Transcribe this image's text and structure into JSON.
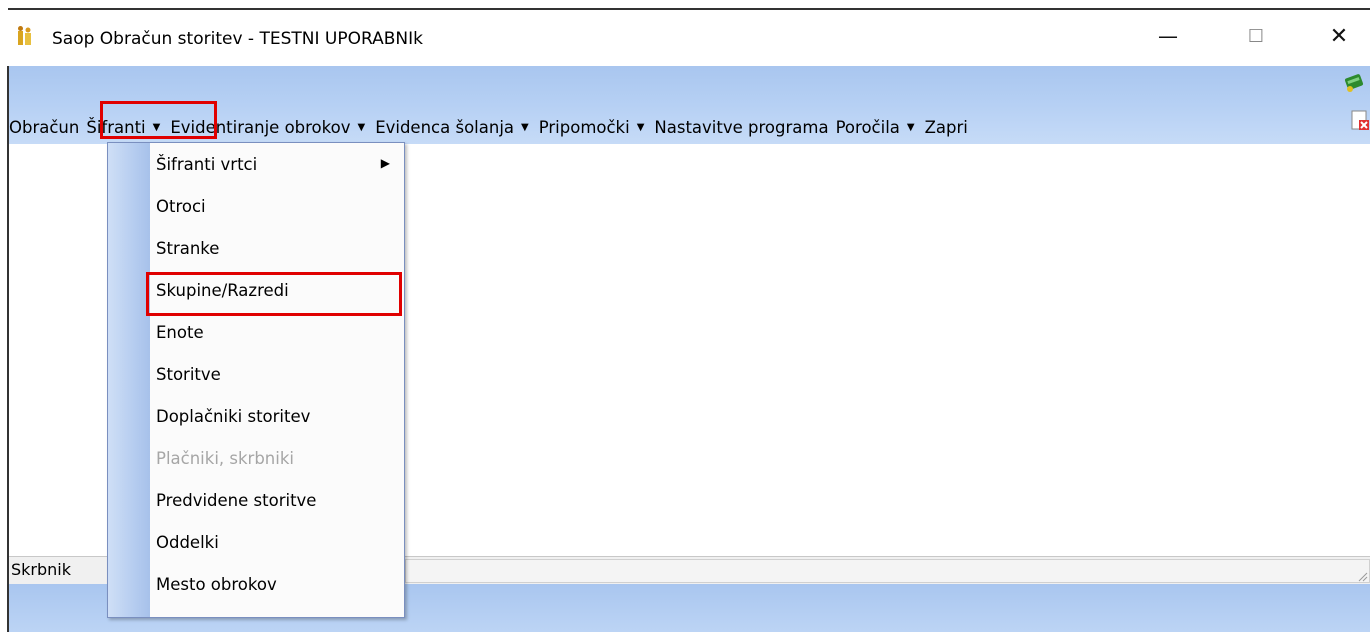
{
  "window": {
    "title": "Saop Obračun storitev - TESTNI UPORABNIk",
    "minimize_glyph": "—",
    "maximize_glyph": "☐",
    "close_glyph": "✕"
  },
  "menubar": {
    "items": [
      {
        "label": "Obračun",
        "has_caret": false
      },
      {
        "label": "Šifranti",
        "has_caret": true
      },
      {
        "label": "Evidentiranje obrokov",
        "has_caret": true
      },
      {
        "label": "Evidenca šolanja",
        "has_caret": true
      },
      {
        "label": "Pripomočki",
        "has_caret": true
      },
      {
        "label": "Nastavitve programa",
        "has_caret": false
      },
      {
        "label": "Poročila",
        "has_caret": true
      },
      {
        "label": "Zapri",
        "has_caret": false
      }
    ],
    "caret_glyph": "▼"
  },
  "dropdown": {
    "items": [
      {
        "label": "Šifranti vrtci",
        "submenu": true,
        "disabled": false
      },
      {
        "label": "Otroci",
        "submenu": false,
        "disabled": false
      },
      {
        "label": "Stranke",
        "submenu": false,
        "disabled": false
      },
      {
        "label": "Skupine/Razredi",
        "submenu": false,
        "disabled": false
      },
      {
        "label": "Enote",
        "submenu": false,
        "disabled": false
      },
      {
        "label": "Storitve",
        "submenu": false,
        "disabled": false
      },
      {
        "label": "Doplačniki storitev",
        "submenu": false,
        "disabled": false
      },
      {
        "label": "Plačniki, skrbniki",
        "submenu": false,
        "disabled": true
      },
      {
        "label": "Predvidene storitve",
        "submenu": false,
        "disabled": false
      },
      {
        "label": "Oddelki",
        "submenu": false,
        "disabled": false
      },
      {
        "label": "Mesto obrokov",
        "submenu": false,
        "disabled": false
      }
    ],
    "submenu_arrow": "▶"
  },
  "statusbar": {
    "text": "Skrbnik"
  },
  "colors": {
    "highlight": "#e00000",
    "menubar": "#b6d0f4"
  }
}
